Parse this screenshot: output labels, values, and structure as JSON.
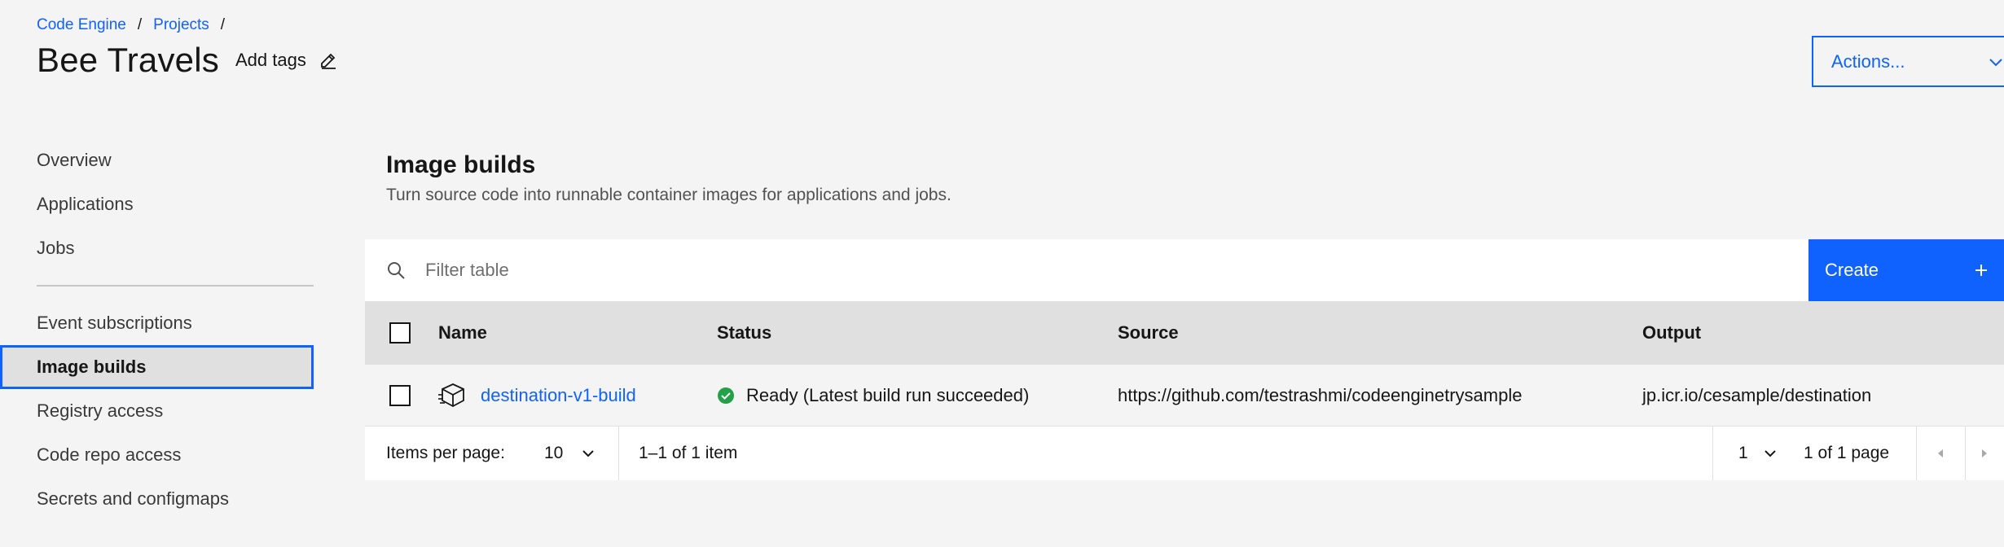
{
  "breadcrumb": {
    "item1": "Code Engine",
    "item2": "Projects",
    "sep": "/"
  },
  "header": {
    "title": "Bee Travels",
    "add_tags": "Add tags",
    "actions_label": "Actions..."
  },
  "sidebar": {
    "items": [
      "Overview",
      "Applications",
      "Jobs"
    ],
    "items2": [
      "Event subscriptions",
      "Image builds",
      "Registry access",
      "Code repo access",
      "Secrets and configmaps"
    ],
    "active": "Image builds"
  },
  "main": {
    "title": "Image builds",
    "description": "Turn source code into runnable container images for applications and jobs.",
    "filter_placeholder": "Filter table",
    "create_label": "Create",
    "columns": {
      "name": "Name",
      "status": "Status",
      "source": "Source",
      "output": "Output"
    },
    "rows": [
      {
        "name": "destination-v1-build",
        "status": "Ready (Latest build run succeeded)",
        "source": "https://github.com/testrashmi/codeenginetrysample",
        "output": "jp.icr.io/cesample/destination"
      }
    ]
  },
  "pagination": {
    "items_per_page_label": "Items per page:",
    "items_per_page_value": "10",
    "range": "1–1 of 1 item",
    "page_value": "1",
    "page_of": "1 of 1 page"
  },
  "colors": {
    "accent": "#0f62fe",
    "success": "#24a148",
    "background": "#f4f4f4"
  }
}
